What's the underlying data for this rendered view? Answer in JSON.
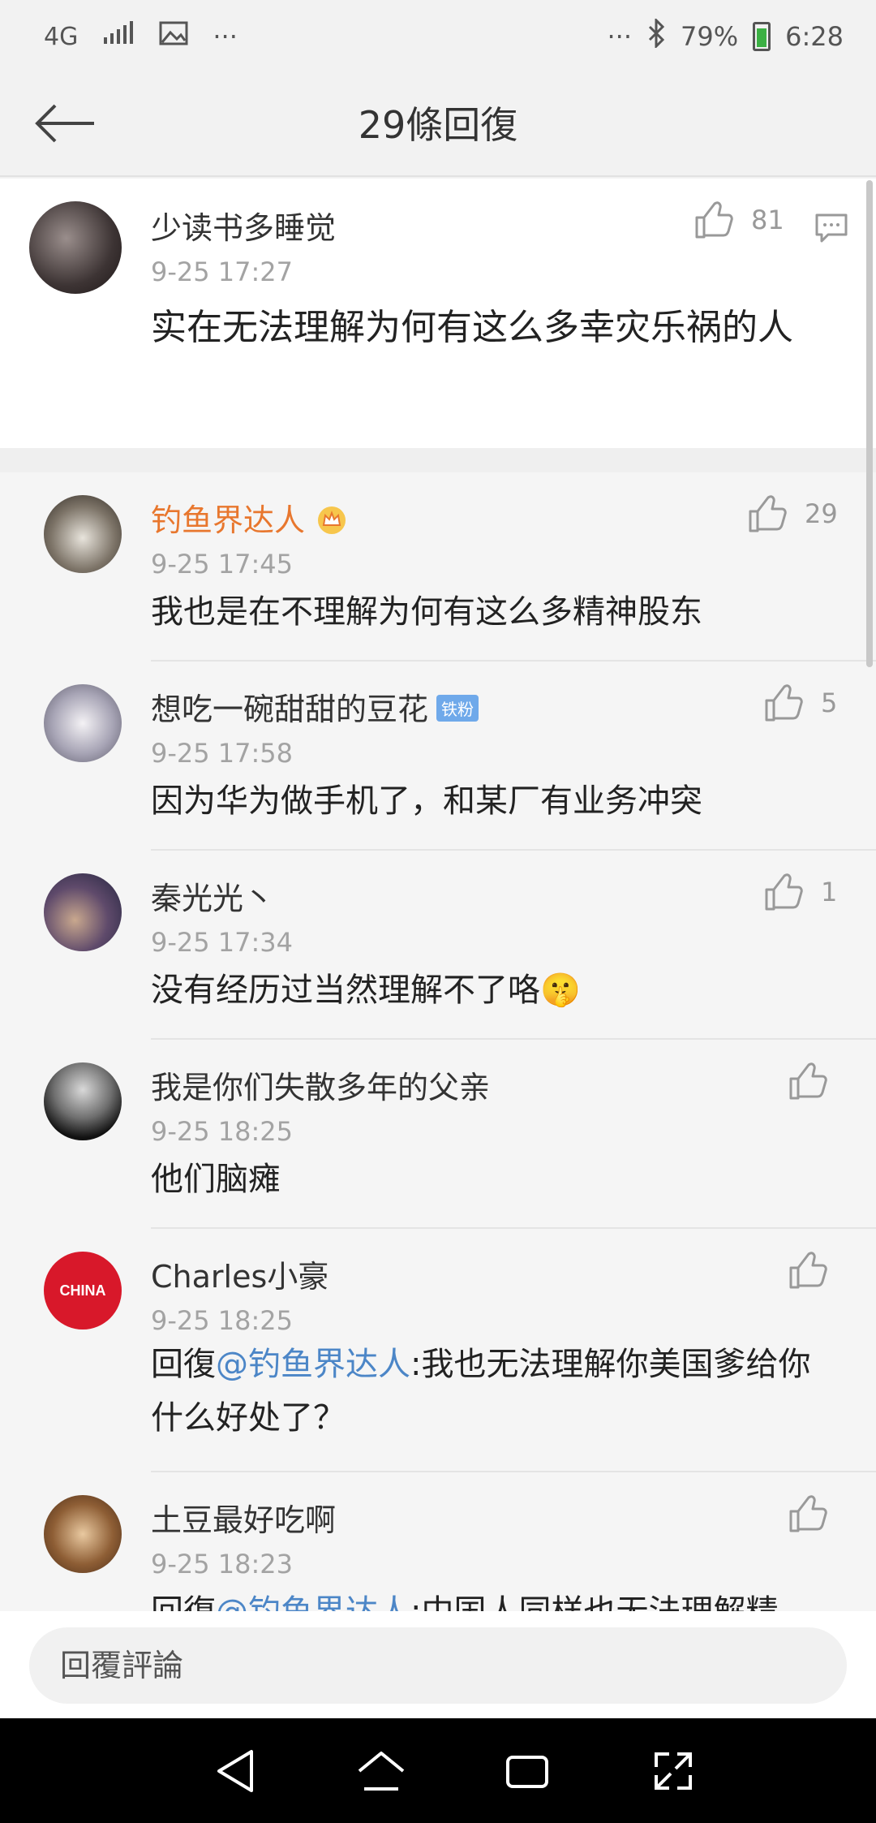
{
  "status_bar": {
    "network": "4G",
    "dots_left": "···",
    "dots_right": "···",
    "battery": "79%",
    "time": "6:28"
  },
  "header": {
    "title": "29條回復"
  },
  "main_comment": {
    "username": "少读书多睡觉",
    "time": "9-25 17:27",
    "text": "实在无法理解为何有这么多幸灾乐祸的人",
    "likes": "81"
  },
  "replies": [
    {
      "username": "钓鱼界达人",
      "time": "9-25 17:45",
      "text": "我也是在不理解为何有这么多精神股东",
      "likes": "29"
    },
    {
      "username": "想吃一碗甜甜的豆花",
      "badge": "铁粉",
      "time": "9-25 17:58",
      "text": "因为华为做手机了，和某厂有业务冲突",
      "likes": "5"
    },
    {
      "username": "秦光光丶",
      "time": "9-25 17:34",
      "text": "没有经历过当然理解不了咯🤫",
      "likes": "1"
    },
    {
      "username": "我是你们失散多年的父亲",
      "time": "9-25 18:25",
      "text": "他们脑瘫",
      "likes": ""
    },
    {
      "username": "Charles小豪",
      "avatar_text": "CHINA",
      "time": "9-25 18:25",
      "text_prefix": "回復",
      "mention": "@钓鱼界达人",
      "text_suffix": ":我也无法理解你美国爹给你什么好处了？",
      "likes": ""
    },
    {
      "username": "土豆最好吃啊",
      "time": "9-25 18:23",
      "text_prefix": "回復",
      "mention": "@钓鱼界达人",
      "text_suffix": ":中国人同样也无法理解精",
      "likes": ""
    }
  ],
  "input": {
    "placeholder": "回覆評論"
  },
  "colors": {
    "vip_name": "#e8772e",
    "mention": "#4c86c7",
    "badge": "#6fa9ea"
  }
}
